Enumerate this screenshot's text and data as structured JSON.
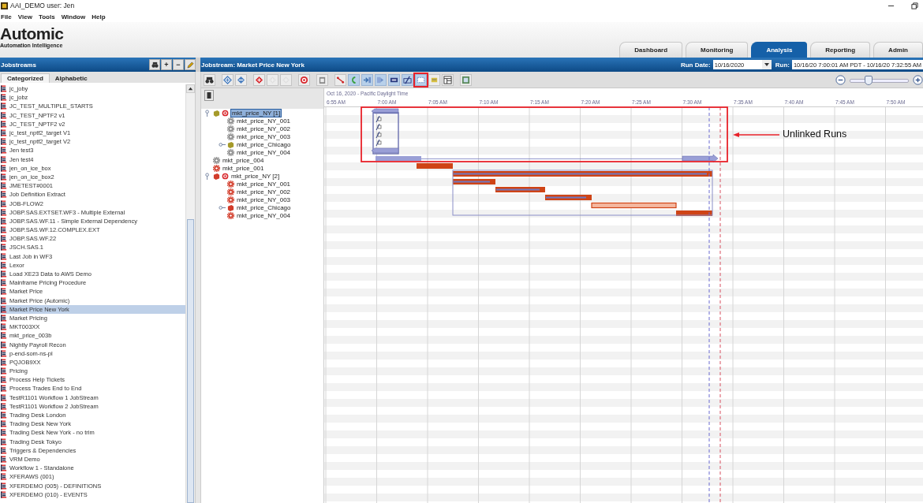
{
  "window": {
    "title": "AAI_DEMO user: Jen"
  },
  "menu": [
    "File",
    "View",
    "Tools",
    "Window",
    "Help"
  ],
  "brand": {
    "name": "Automic",
    "tagline": "Automation Intelligence"
  },
  "nav_tabs": [
    {
      "label": "Dashboard",
      "selected": false
    },
    {
      "label": "Monitoring",
      "selected": false
    },
    {
      "label": "Analysis",
      "selected": true
    },
    {
      "label": "Reporting",
      "selected": false
    },
    {
      "label": "Admin",
      "selected": false
    }
  ],
  "jobstreams": {
    "title": "Jobstreams",
    "buttons": [
      "+",
      "−"
    ],
    "tabs": [
      {
        "label": "Categorized",
        "selected": true
      },
      {
        "label": "Alphabetic",
        "selected": false
      }
    ],
    "items": [
      {
        "label": "jc_joby",
        "selected": false
      },
      {
        "label": "jc_jobz",
        "selected": false
      },
      {
        "label": "JC_TEST_MULTIPLE_STARTS",
        "selected": false
      },
      {
        "label": "JC_TEST_NPTF2 v1",
        "selected": false
      },
      {
        "label": "JC_TEST_NPTF2 v2",
        "selected": false
      },
      {
        "label": "jc_test_nptf2_target V1",
        "selected": false
      },
      {
        "label": "jc_test_nptf2_target V2",
        "selected": false
      },
      {
        "label": "Jen test3",
        "selected": false
      },
      {
        "label": "Jen test4",
        "selected": false
      },
      {
        "label": "jen_on_ice_box",
        "selected": false
      },
      {
        "label": "jen_on_ice_box2",
        "selected": false
      },
      {
        "label": "JMETEST#0001",
        "selected": false
      },
      {
        "label": "Job Definition Extract",
        "selected": false
      },
      {
        "label": "JOB-FLOW2",
        "selected": false
      },
      {
        "label": "JOBP.SAS.EXTSET.WF3 - Multiple External",
        "selected": false
      },
      {
        "label": "JOBP.SAS.WF.11 - Simple External Dependency",
        "selected": false
      },
      {
        "label": "JOBP.SAS.WF.12.COMPLEX.EXT",
        "selected": false
      },
      {
        "label": "JOBP.SAS.WF.22",
        "selected": false
      },
      {
        "label": "JSCH.SAS.1",
        "selected": false
      },
      {
        "label": "Last Job in WF3",
        "selected": false
      },
      {
        "label": "Lexor",
        "selected": false
      },
      {
        "label": "Load XE23 Data to AWS Demo",
        "selected": false
      },
      {
        "label": "Mainframe Pricing Procedure",
        "selected": false
      },
      {
        "label": "Market Price",
        "selected": false
      },
      {
        "label": "Market Price (Automic)",
        "selected": false
      },
      {
        "label": "Market Price New York",
        "selected": true
      },
      {
        "label": "Market Pricing",
        "selected": false
      },
      {
        "label": "MKT003XX",
        "selected": false
      },
      {
        "label": "mkt_price_003b",
        "selected": false
      },
      {
        "label": "Nightly Payroll Recon",
        "selected": false
      },
      {
        "label": "p-end-som-ns-pl",
        "selected": false
      },
      {
        "label": "PQJOB9XX",
        "selected": false
      },
      {
        "label": "Pricing",
        "selected": false
      },
      {
        "label": "Process Help Tickets",
        "selected": false
      },
      {
        "label": "Process Trades End to End",
        "selected": false
      },
      {
        "label": "TestR1101 Workflow 1 JobStream",
        "selected": false
      },
      {
        "label": "TestR1101 Workflow 2 JobStream",
        "selected": false
      },
      {
        "label": "Trading Desk London",
        "selected": false
      },
      {
        "label": "Trading Desk New York",
        "selected": false
      },
      {
        "label": "Trading Desk New York - no trim",
        "selected": false
      },
      {
        "label": "Trading Desk Tokyo",
        "selected": false
      },
      {
        "label": "Triggers & Dependencies",
        "selected": false
      },
      {
        "label": "VRM Demo",
        "selected": false
      },
      {
        "label": "Workflow 1 - Standalone",
        "selected": false
      },
      {
        "label": "XFERAWS (001)",
        "selected": false
      },
      {
        "label": "XFERDEMO (005) - DEFINITIONS",
        "selected": false
      },
      {
        "label": "XFERDEMO (010) - EVENTS",
        "selected": false
      }
    ]
  },
  "jobstream": {
    "title": "Jobstream: Market Price New York",
    "run_date_label": "Run Date:",
    "run_date": "10/16/2020",
    "run_label": "Run:",
    "run": "10/16/20 7:00:01 AM PDT - 10/16/20 7:32:55 AM",
    "toolbar": [
      {
        "kind": "binoculars",
        "on": false,
        "disabled": false,
        "marked": false
      },
      {
        "kind": "expand",
        "on": false,
        "disabled": false,
        "marked": false
      },
      {
        "kind": "collapse",
        "on": false,
        "disabled": false,
        "marked": false
      },
      {
        "kind": "diamond",
        "on": false,
        "disabled": false,
        "marked": false
      },
      {
        "kind": "diamond",
        "on": false,
        "disabled": true,
        "marked": false
      },
      {
        "kind": "diamond",
        "on": false,
        "disabled": true,
        "marked": false
      },
      {
        "kind": "target",
        "on": false,
        "disabled": false,
        "marked": false
      },
      {
        "kind": "clipboard",
        "on": false,
        "disabled": false,
        "marked": false
      },
      {
        "kind": "link",
        "on": false,
        "disabled": false,
        "marked": false
      },
      {
        "kind": "hook",
        "on": true,
        "disabled": false,
        "marked": false
      },
      {
        "kind": "enter",
        "on": true,
        "disabled": false,
        "marked": false
      },
      {
        "kind": "exit",
        "on": true,
        "disabled": false,
        "marked": false
      },
      {
        "kind": "bar",
        "on": true,
        "disabled": false,
        "marked": false
      },
      {
        "kind": "slash",
        "on": true,
        "disabled": false,
        "marked": false
      },
      {
        "kind": "frame",
        "on": true,
        "disabled": false,
        "marked": true
      },
      {
        "kind": "note",
        "on": false,
        "disabled": false,
        "marked": false
      },
      {
        "kind": "table",
        "on": false,
        "disabled": false,
        "marked": false
      },
      {
        "kind": "sheet",
        "on": false,
        "disabled": false,
        "marked": false
      }
    ],
    "zoom": {
      "level": 0.3
    },
    "date_label": "Oct 16, 2020 - Pacific Daylight Time",
    "ticks": [
      "6:55 AM",
      "7:00 AM",
      "7:05 AM",
      "7:10 AM",
      "7:15 AM",
      "7:20 AM",
      "7:25 AM",
      "7:30 AM",
      "7:35 AM",
      "7:40 AM",
      "7:45 AM",
      "7:50 AM"
    ],
    "tree": [
      {
        "label": "mkt_price_NY [1]",
        "kind": "workflow",
        "color": "#a59a2a",
        "expanded": true,
        "selected": true,
        "children": [
          {
            "label": "mkt_price_NY_001",
            "kind": "job",
            "color": "#8c8c8c",
            "selected": false
          },
          {
            "label": "mkt_price_NY_002",
            "kind": "job",
            "color": "#8c8c8c",
            "selected": false
          },
          {
            "label": "mkt_price_NY_003",
            "kind": "job",
            "color": "#8c8c8c",
            "selected": false
          },
          {
            "label": "mkt_price_Chicago",
            "kind": "subflow",
            "color": "#a59a2a",
            "expanded": false,
            "selected": false
          },
          {
            "label": "mkt_price_NY_004",
            "kind": "job",
            "color": "#8c8c8c",
            "selected": false
          }
        ]
      },
      {
        "label": "mkt_price_004",
        "kind": "job",
        "color": "#8c8c8c",
        "selected": false
      },
      {
        "label": "mkt_price_001",
        "kind": "job",
        "color": "#d23c2a",
        "selected": false
      },
      {
        "label": "mkt_price_NY [2]",
        "kind": "workflow",
        "color": "#d23c2a",
        "expanded": true,
        "selected": false,
        "children": [
          {
            "label": "mkt_price_NY_001",
            "kind": "job",
            "color": "#d23c2a",
            "selected": false
          },
          {
            "label": "mkt_price_NY_002",
            "kind": "job",
            "color": "#d23c2a",
            "selected": false
          },
          {
            "label": "mkt_price_NY_003",
            "kind": "job",
            "color": "#d23c2a",
            "selected": false
          },
          {
            "label": "mkt_price_Chicago",
            "kind": "subflow",
            "color": "#d23c2a",
            "expanded": false,
            "selected": false
          },
          {
            "label": "mkt_price_NY_004",
            "kind": "job",
            "color": "#d23c2a",
            "selected": false
          }
        ]
      }
    ],
    "annotation": {
      "text": "Unlinked Runs"
    }
  }
}
